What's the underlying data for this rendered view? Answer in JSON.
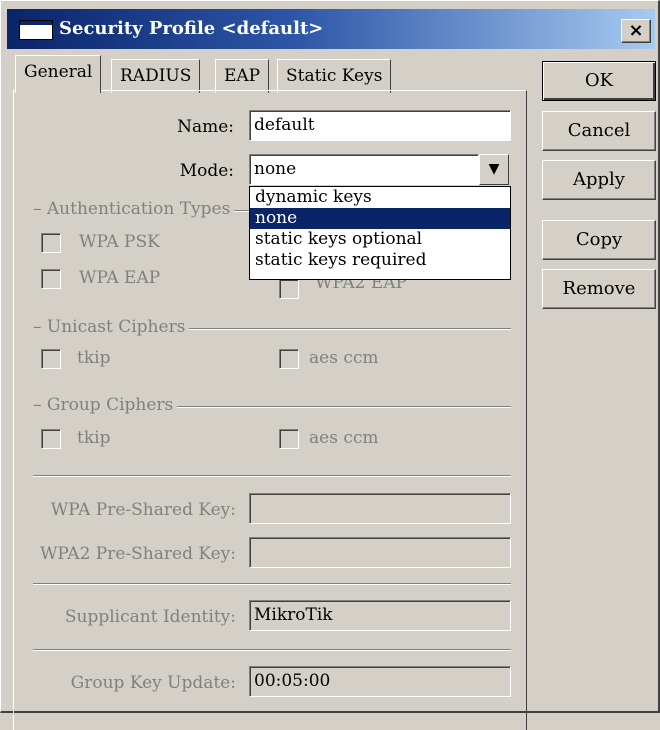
{
  "window": {
    "title": "Security Profile <default>",
    "close_glyph": "×"
  },
  "tabs": [
    {
      "label": "General",
      "active": true
    },
    {
      "label": "RADIUS",
      "active": false
    },
    {
      "label": "EAP",
      "active": false
    },
    {
      "label": "Static Keys",
      "active": false
    }
  ],
  "form": {
    "name_label": "Name:",
    "name_value": "default",
    "mode_label": "Mode:",
    "mode_value": "none",
    "mode_dropdown_glyph": "▼",
    "mode_options": [
      "dynamic keys",
      "none",
      "static keys optional",
      "static keys required"
    ],
    "mode_selected_index": 1,
    "auth_group": "Authentication Types",
    "auth_options": {
      "wpa_psk": "WPA PSK",
      "wpa_eap": "WPA EAP",
      "wpa2_eap_partial": "WPA2 EAP"
    },
    "unicast_group": "Unicast Ciphers",
    "unicast_options": {
      "tkip": "tkip",
      "aes": "aes ccm"
    },
    "group_ciphers_group": "Group Ciphers",
    "group_options": {
      "tkip": "tkip",
      "aes": "aes ccm"
    },
    "wpa_psk_label": "WPA Pre-Shared Key:",
    "wpa_psk_value": "",
    "wpa2_psk_label": "WPA2 Pre-Shared Key:",
    "wpa2_psk_value": "",
    "supplicant_label": "Supplicant Identity:",
    "supplicant_value": "MikroTik",
    "group_key_label": "Group Key Update:",
    "group_key_value": "00:05:00"
  },
  "buttons": {
    "ok": "OK",
    "cancel": "Cancel",
    "apply": "Apply",
    "copy": "Copy",
    "remove": "Remove"
  },
  "colors": {
    "titlebar_start": "#0a246a",
    "selection": "#0a246a",
    "face": "#d4d0c8"
  }
}
